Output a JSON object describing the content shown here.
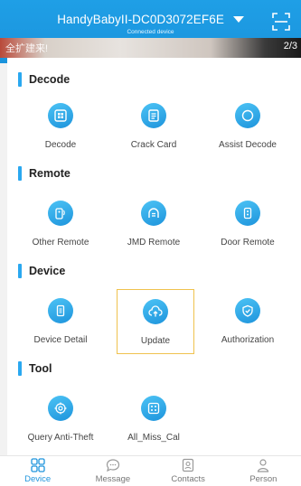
{
  "header": {
    "device_name": "HandyBabyII-DC0D3072EF6E",
    "connected_label": "Connected device",
    "banner_text": "全扩建来!",
    "banner_page": "2/3",
    "accent_color": "#1f9fe6"
  },
  "sections": [
    {
      "title": "Decode",
      "items": [
        {
          "label": "Decode",
          "icon": "chip-grid-icon"
        },
        {
          "label": "Crack Card",
          "icon": "card-doc-icon"
        },
        {
          "label": "Assist Decode",
          "icon": "circle-icon"
        }
      ]
    },
    {
      "title": "Remote",
      "items": [
        {
          "label": "Other Remote",
          "icon": "remote-signal-icon"
        },
        {
          "label": "JMD Remote",
          "icon": "arch-remote-icon"
        },
        {
          "label": "Door Remote",
          "icon": "door-remote-icon"
        }
      ]
    },
    {
      "title": "Device",
      "items": [
        {
          "label": "Device Detail",
          "icon": "device-icon"
        },
        {
          "label": "Update",
          "icon": "cloud-upload-icon"
        },
        {
          "label": "Authorization",
          "icon": "shield-check-icon"
        }
      ]
    },
    {
      "title": "Tool",
      "items": [
        {
          "label": "Query Anti-Theft",
          "icon": "target-icon"
        },
        {
          "label": "All_Miss_Cal",
          "icon": "grid-box-icon"
        }
      ]
    }
  ],
  "bottom_nav": [
    {
      "label": "Device",
      "icon": "grid-four-icon",
      "active": true
    },
    {
      "label": "Message",
      "icon": "chat-bubble-icon",
      "active": false
    },
    {
      "label": "Contacts",
      "icon": "contacts-icon",
      "active": false
    },
    {
      "label": "Person",
      "icon": "person-icon",
      "active": false
    }
  ]
}
